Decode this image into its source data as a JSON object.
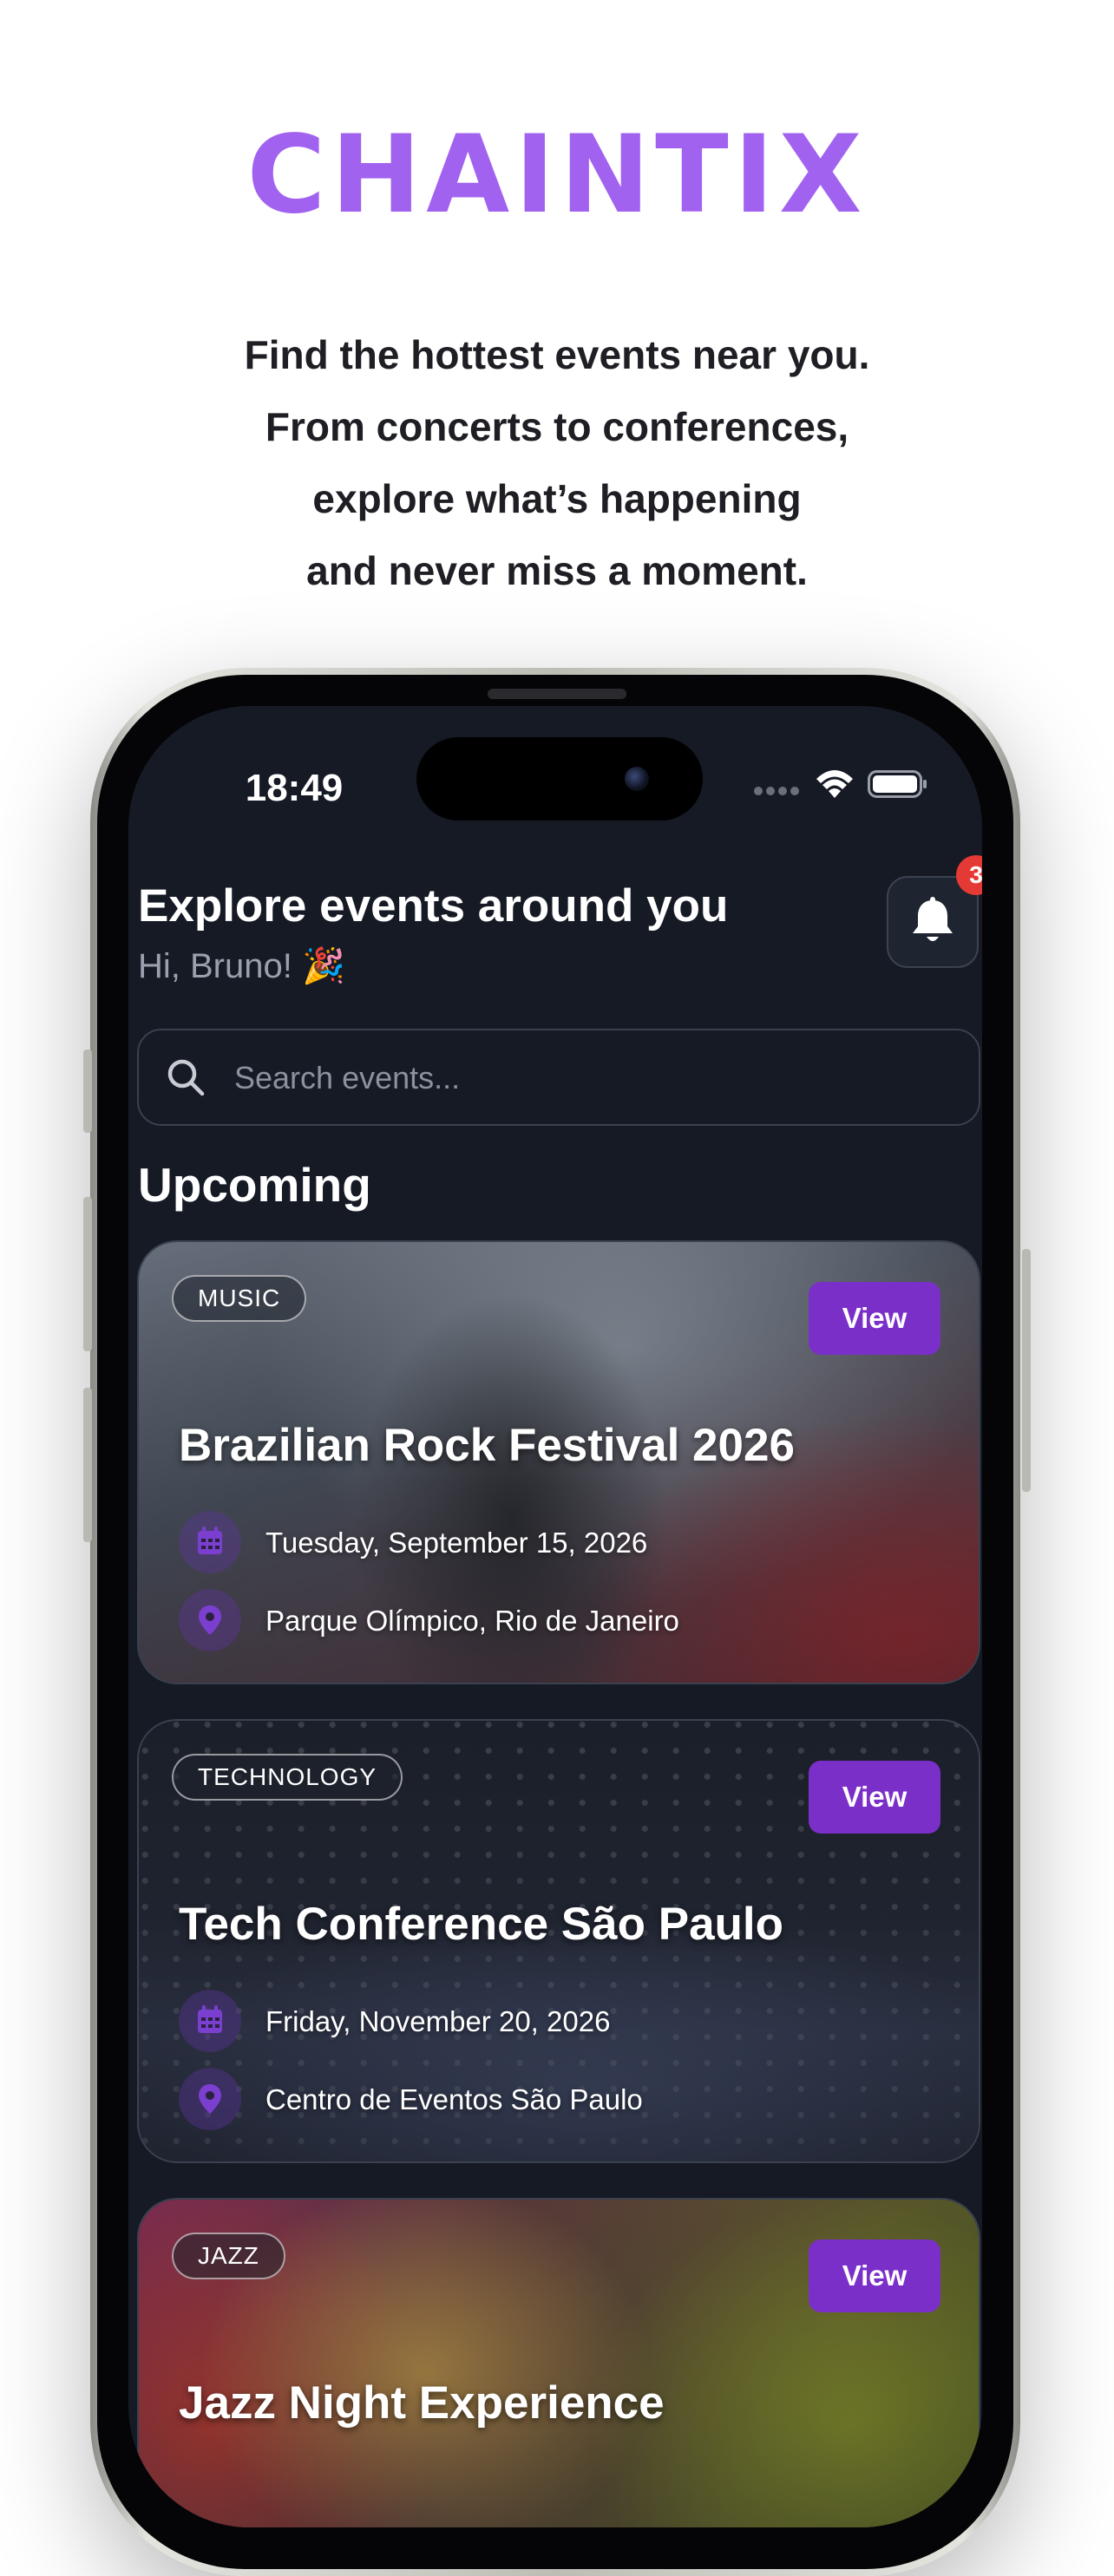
{
  "brand": {
    "logo_text": "CHAINTIX",
    "accent_color": "#a262f0"
  },
  "tagline": [
    "Find the hottest events near you.",
    "From concerts to conferences,",
    "explore what’s happening",
    "and never miss a moment."
  ],
  "status_bar": {
    "time": "18:49",
    "icons": [
      "signal-dots-icon",
      "wifi-icon",
      "battery-icon"
    ]
  },
  "header": {
    "title": "Explore events around you",
    "greeting": "Hi, Bruno! 🎉",
    "notifications": {
      "icon": "bell-icon",
      "count": "3"
    }
  },
  "search": {
    "placeholder": "Search events...",
    "value": "",
    "icon": "search-icon"
  },
  "section": {
    "title": "Upcoming"
  },
  "events": [
    {
      "category": "MUSIC",
      "title": "Brazilian Rock Festival 2026",
      "date": "Tuesday, September 15, 2026",
      "location": "Parque Olímpico, Rio de Janeiro",
      "button": "View"
    },
    {
      "category": "TECHNOLOGY",
      "title": "Tech Conference São Paulo",
      "date": "Friday, November 20, 2026",
      "location": "Centro de Eventos São Paulo",
      "button": "View"
    },
    {
      "category": "JAZZ",
      "title": "Jazz Night Experience",
      "button": "View"
    }
  ],
  "colors": {
    "screen_bg": "#151a25",
    "button": "#7b2fc9",
    "badge": "#e53935"
  }
}
